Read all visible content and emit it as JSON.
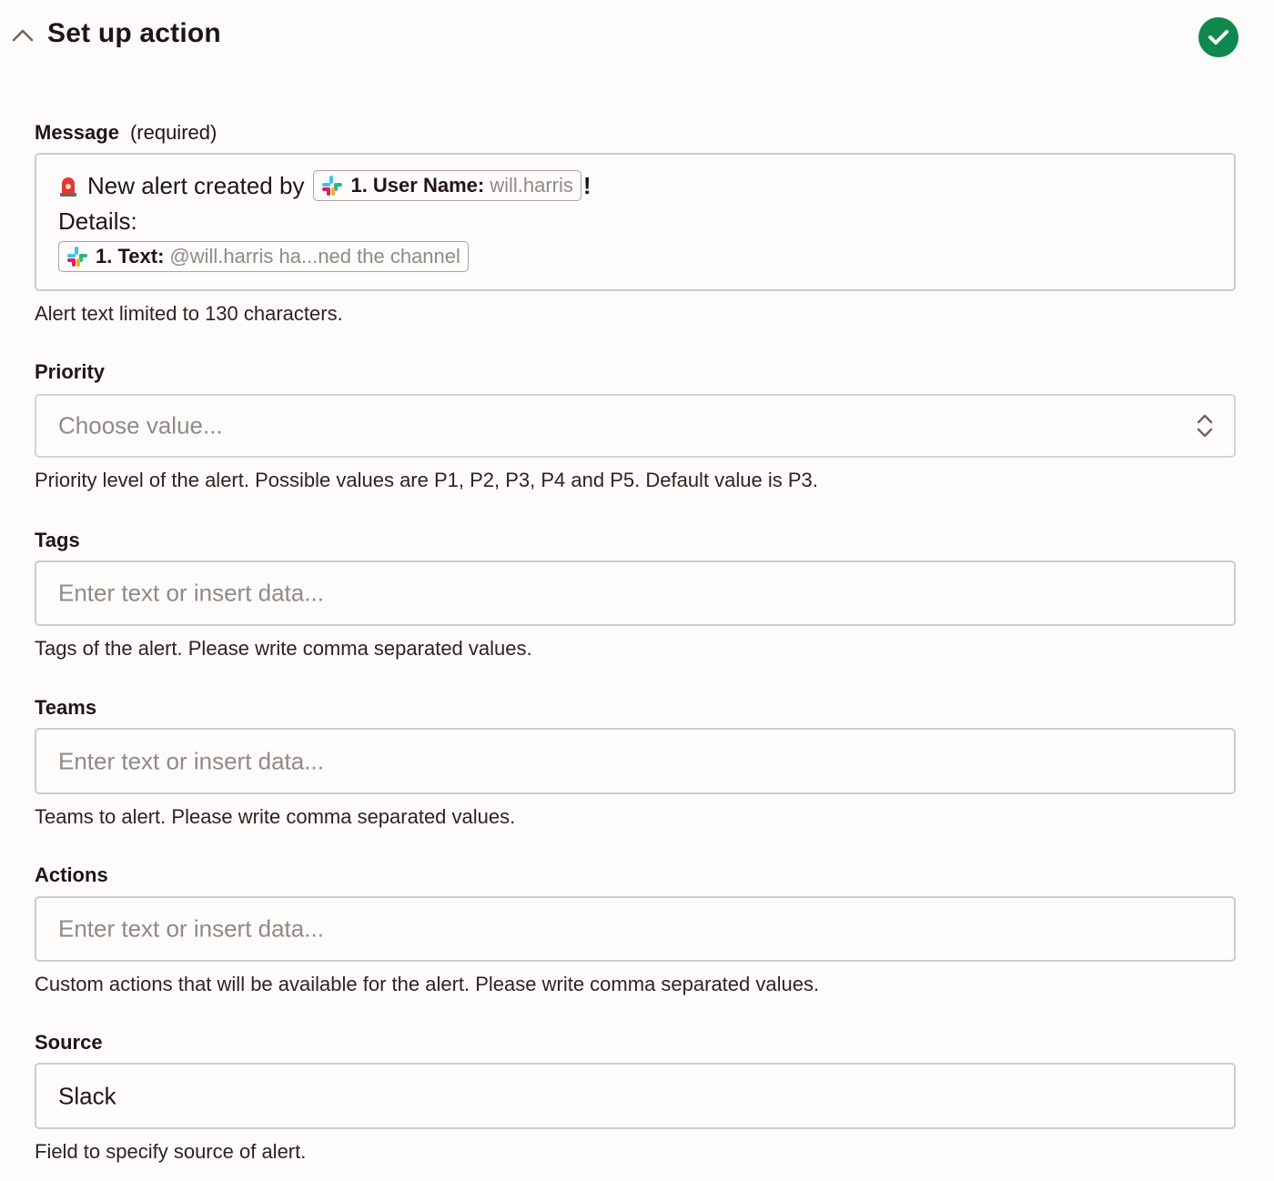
{
  "header": {
    "title": "Set up action",
    "collapse_icon": "chevron-up-icon",
    "status_icon": "check-circle-icon",
    "status_color": "#0f884e"
  },
  "message": {
    "label": "Message",
    "required": "(required)",
    "line1_text": "New alert created by",
    "line1_emoji": "rotating-light-icon",
    "pill1_key": "1. User Name:",
    "pill1_value": "will.harris",
    "line1_suffix": "!",
    "line2_text": "Details:",
    "pill2_key": "1. Text:",
    "pill2_value": "@will.harris ha...ned the channel",
    "pill_icon": "slack-icon",
    "help": "Alert text limited to 130 characters."
  },
  "priority": {
    "label": "Priority",
    "placeholder": "Choose value...",
    "help": "Priority level of the alert. Possible values are P1, P2, P3, P4 and P5. Default value is P3."
  },
  "tags": {
    "label": "Tags",
    "placeholder": "Enter text or insert data...",
    "help": "Tags of the alert. Please write comma separated values."
  },
  "teams": {
    "label": "Teams",
    "placeholder": "Enter text or insert data...",
    "help": "Teams to alert. Please write comma separated values."
  },
  "actions": {
    "label": "Actions",
    "placeholder": "Enter text or insert data...",
    "help": "Custom actions that will be available for the alert. Please write comma separated values."
  },
  "source": {
    "label": "Source",
    "value": "Slack",
    "help": "Field to specify source of alert."
  }
}
